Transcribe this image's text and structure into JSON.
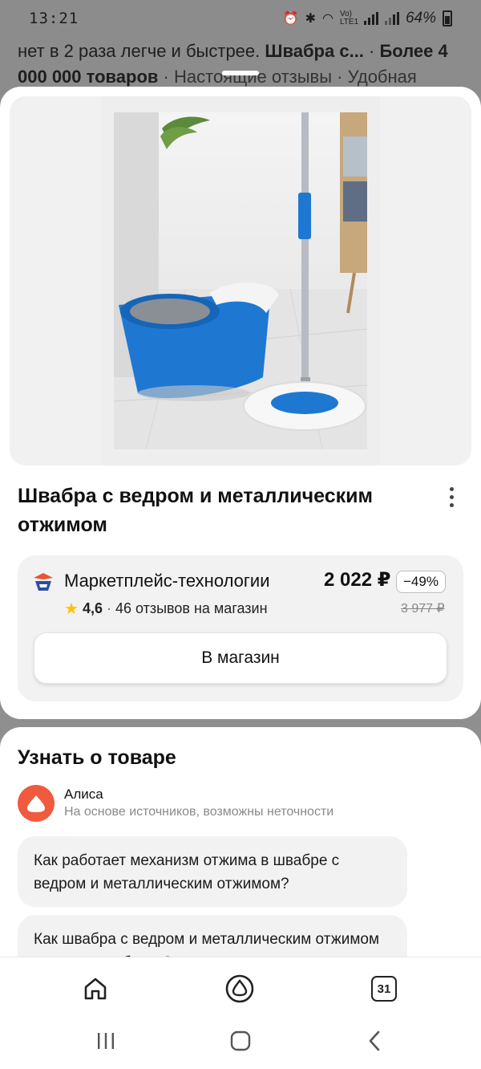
{
  "status_bar": {
    "time": "13:21",
    "network_label": "Vo) LTE1",
    "battery": "64%"
  },
  "background_page": {
    "line1_prefix": "нет в 2 раза легче и быстрее. ",
    "line1_bold": "Швабра с...",
    "line1_sep": " · ",
    "line1_bold2": "Более 4",
    "line2_bold": "000 000 товаров",
    "line2_rest": " · Настоящие отзывы · Удобная"
  },
  "product": {
    "title": "Швабра с ведром и металлическим отжимом",
    "image_icon": "mop-bucket-photo"
  },
  "offer": {
    "shop_name": "Маркетплейс-технологии",
    "rating": "4,6",
    "reviews": "46 отзывов на магазин",
    "price": "2 022 ₽",
    "discount": "−49%",
    "old_price": "3 977 ₽",
    "button_label": "В магазин"
  },
  "learn": {
    "title": "Узнать о товаре",
    "assistant_name": "Алиса",
    "assistant_note": "На основе источников, возможны неточности",
    "questions": [
      "Как работает механизм отжима в швабре с ведром и металлическим отжимом?",
      "Как швабра с ведром и металлическим отжимом помогает в уборке?"
    ]
  },
  "bottom_nav": {
    "home_icon": "home-icon",
    "alice_icon": "alice-icon",
    "tabs_count": "31"
  },
  "colors": {
    "accent_alice": "#f05a3f",
    "star": "#ffc107",
    "bucket_blue": "#1e78d2"
  }
}
